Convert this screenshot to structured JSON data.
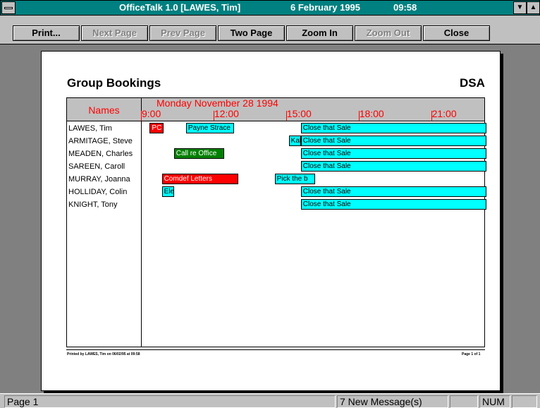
{
  "window": {
    "app_title": "OfficeTalk 1.0 [LAWES, Tim]",
    "date": "6 February 1995",
    "time": "09:58"
  },
  "toolbar": {
    "print_label": "Print...",
    "next_page_label": "Next Page",
    "prev_page_label": "Prev Page",
    "two_page_label": "Two Page",
    "zoom_in_label": "Zoom In",
    "zoom_out_label": "Zoom Out",
    "close_label": "Close"
  },
  "report": {
    "title": "Group Bookings",
    "org": "DSA",
    "names_header": "Names",
    "date_header": "Monday November 28 1994",
    "times": [
      "9:00",
      "12:00",
      "15:00",
      "18:00",
      "21:00"
    ],
    "people": [
      "LAWES, Tim",
      "ARMITAGE, Steve",
      "MEADEN, Charles",
      "SAREEN, Caroll",
      "MURRAY, Joanna",
      "HOLLIDAY, Colin",
      "KNIGHT, Tony"
    ],
    "bookings": [
      {
        "row": 0,
        "label": "PC",
        "color": "#ff0000",
        "start": "09:20",
        "end": "09:55"
      },
      {
        "row": 0,
        "label": "Payne Strace",
        "color": "#00ffff",
        "start": "10:50",
        "end": "12:50"
      },
      {
        "row": 0,
        "label": "Close that Sale",
        "color": "#00ffff",
        "start": "15:35",
        "end": "23:15"
      },
      {
        "row": 1,
        "label": "Kal",
        "color": "#00ffff",
        "start": "15:05",
        "end": "15:35"
      },
      {
        "row": 1,
        "label": "Close that Sale",
        "color": "#00ffff",
        "start": "15:35",
        "end": "23:15"
      },
      {
        "row": 2,
        "label": "Call re Office",
        "color": "#008000",
        "start": "10:20",
        "end": "12:25"
      },
      {
        "row": 2,
        "label": "Close that Sale",
        "color": "#00ffff",
        "start": "15:35",
        "end": "23:15"
      },
      {
        "row": 3,
        "label": "Close that Sale",
        "color": "#00ffff",
        "start": "15:35",
        "end": "23:15"
      },
      {
        "row": 4,
        "label": "Comdef Letters",
        "color": "#ff0000",
        "start": "09:50",
        "end": "13:00"
      },
      {
        "row": 4,
        "label": "Pick the b",
        "color": "#00ffff",
        "start": "14:30",
        "end": "16:10"
      },
      {
        "row": 5,
        "label": "Ele",
        "color": "#00ffff",
        "start": "09:50",
        "end": "10:20"
      },
      {
        "row": 5,
        "label": "Close that Sale",
        "color": "#00ffff",
        "start": "15:35",
        "end": "23:15"
      },
      {
        "row": 6,
        "label": "Close that Sale",
        "color": "#00ffff",
        "start": "15:35",
        "end": "23:15"
      }
    ],
    "footer_left": "Printed by LAWES, Tim on 06/02/95 at 09:58",
    "footer_right": "Page 1 of 1"
  },
  "status": {
    "page": "Page 1",
    "messages": "7 New Message(s)",
    "num": "NUM"
  }
}
